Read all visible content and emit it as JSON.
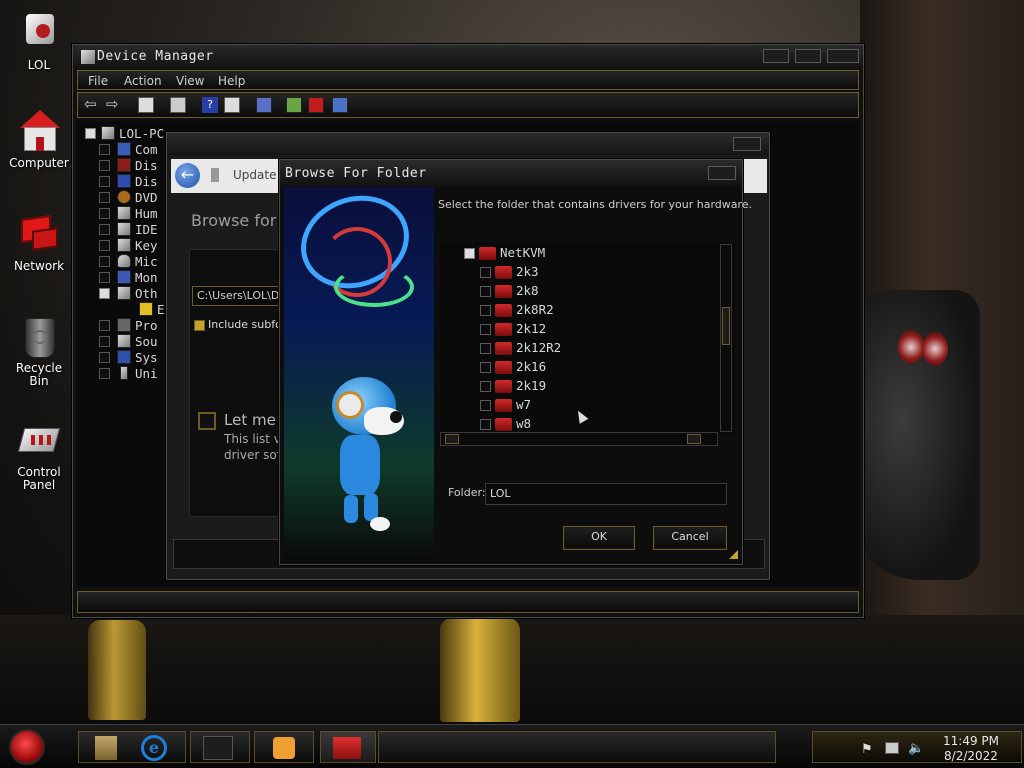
{
  "desktop": {
    "icons": [
      {
        "label": "LOL",
        "icon": "user-folder-icon"
      },
      {
        "label": "Computer",
        "icon": "computer-icon"
      },
      {
        "label": "Network",
        "icon": "network-icon"
      },
      {
        "label": "Recycle Bin",
        "icon": "recycle-bin-icon"
      },
      {
        "label": "Control Panel",
        "icon": "control-panel-icon"
      }
    ]
  },
  "device_manager": {
    "title": "Device Manager",
    "menu": [
      "File",
      "Action",
      "View",
      "Help"
    ],
    "root": "LOL-PC",
    "categories": [
      "Com",
      "Dis",
      "Dis",
      "DVD",
      "Hum",
      "IDE",
      "Key",
      "Mic",
      "Mon",
      "Oth",
      "E",
      "Pro",
      "Sou",
      "Sys",
      "Uni"
    ]
  },
  "update_wizard": {
    "title": "Update D",
    "heading": "Browse for d",
    "path_value": "C:\\Users\\LOL\\D",
    "include_label": "Include subfo",
    "let_me_label": "Let me p",
    "list_desc_1": "This list v",
    "list_desc_2": "driver soft"
  },
  "browse_dialog": {
    "title": "Browse For Folder",
    "instruction": "Select the folder that contains drivers for your hardware.",
    "tree_root": "NetKVM",
    "folders": [
      "2k3",
      "2k8",
      "2k8R2",
      "2k12",
      "2k12R2",
      "2k16",
      "2k19",
      "w7",
      "w8"
    ],
    "folder_label": "Folder:",
    "folder_value": "LOL",
    "ok_label": "OK",
    "cancel_label": "Cancel"
  },
  "taskbar": {
    "time": "11:49 PM",
    "date": "8/2/2022",
    "apps": [
      "folder-icon",
      "internet-explorer-icon",
      "window-icon",
      "media-player-icon",
      "toolbox-icon"
    ]
  },
  "colors": {
    "accent_gold": "#6e5c26",
    "folder_red": "#c0201f",
    "start_red": "#c21010"
  }
}
